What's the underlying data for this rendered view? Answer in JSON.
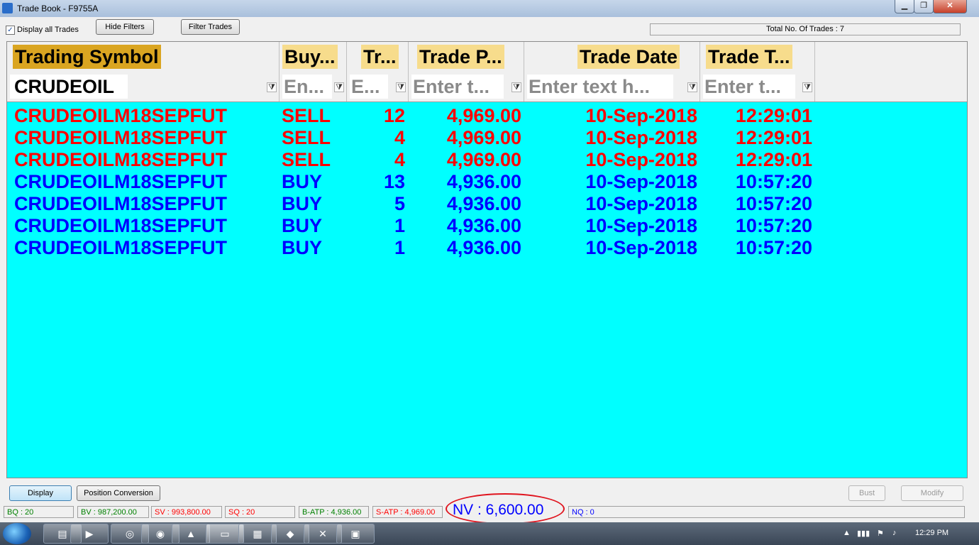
{
  "window": {
    "title": "Trade Book - F9755A"
  },
  "window_controls": {
    "minimize": "▁",
    "maximize": "❐",
    "close": "✕"
  },
  "toolbar": {
    "display_all_label": "Display all Trades",
    "display_all_checked": true,
    "hide_filters": "Hide Filters",
    "filter_trades": "Filter Trades",
    "total_trades": "Total No. Of Trades : 7"
  },
  "grid": {
    "columns": [
      "Trading Symbol",
      "Buy...",
      "Tr...",
      "Trade P...",
      "Trade Date",
      "Trade T..."
    ],
    "filters": [
      {
        "value": "CRUDEOIL",
        "placeholder": ""
      },
      {
        "value": "",
        "placeholder": "En..."
      },
      {
        "value": "",
        "placeholder": "E..."
      },
      {
        "value": "",
        "placeholder": "Enter t..."
      },
      {
        "value": "",
        "placeholder": "Enter text h..."
      },
      {
        "value": "",
        "placeholder": "Enter t..."
      }
    ],
    "rows": [
      {
        "symbol": "CRUDEOILM18SEPFUT",
        "side": "SELL",
        "qty": "12",
        "price": "4,969.00",
        "date": "10-Sep-2018",
        "time": "12:29:01"
      },
      {
        "symbol": "CRUDEOILM18SEPFUT",
        "side": "SELL",
        "qty": "4",
        "price": "4,969.00",
        "date": "10-Sep-2018",
        "time": "12:29:01"
      },
      {
        "symbol": "CRUDEOILM18SEPFUT",
        "side": "SELL",
        "qty": "4",
        "price": "4,969.00",
        "date": "10-Sep-2018",
        "time": "12:29:01"
      },
      {
        "symbol": "CRUDEOILM18SEPFUT",
        "side": "BUY",
        "qty": "13",
        "price": "4,936.00",
        "date": "10-Sep-2018",
        "time": "10:57:20"
      },
      {
        "symbol": "CRUDEOILM18SEPFUT",
        "side": "BUY",
        "qty": "5",
        "price": "4,936.00",
        "date": "10-Sep-2018",
        "time": "10:57:20"
      },
      {
        "symbol": "CRUDEOILM18SEPFUT",
        "side": "BUY",
        "qty": "1",
        "price": "4,936.00",
        "date": "10-Sep-2018",
        "time": "10:57:20"
      },
      {
        "symbol": "CRUDEOILM18SEPFUT",
        "side": "BUY",
        "qty": "1",
        "price": "4,936.00",
        "date": "10-Sep-2018",
        "time": "10:57:20"
      }
    ],
    "colors": {
      "background": "#00ffff",
      "sell": "#ff0000",
      "buy": "#0000ff",
      "header": "#f7dc8c"
    }
  },
  "bottom_buttons": {
    "display": "Display",
    "position_conversion": "Position Conversion",
    "bust": "Bust",
    "modify": "Modify"
  },
  "status": {
    "bq": "BQ : 20",
    "bv": "BV : 987,200.00",
    "sv": "SV : 993,800.00",
    "sq": "SQ : 20",
    "batp": "B-ATP : 4,936.00",
    "satp": "S-ATP : 4,969.00",
    "nv": "NV : 6,600.00",
    "nq": "NQ : 0"
  },
  "taskbar": {
    "apps": [
      "explorer-icon",
      "media-player-icon",
      "lifebuoy-icon",
      "chrome-icon",
      "triangle-app-icon",
      "trading-app-icon",
      "calculator-icon",
      "chart-app-icon",
      "excel-icon",
      "window-app-icon"
    ],
    "clock": "12:29 PM"
  }
}
